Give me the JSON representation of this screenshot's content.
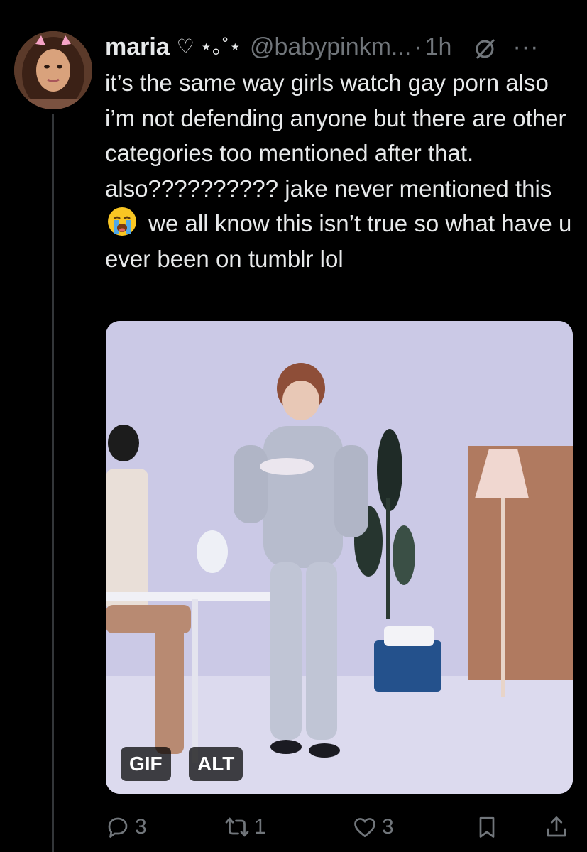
{
  "tweet": {
    "author": {
      "display_name": "maria",
      "name_decoration": "♡ ⋆｡˚⋆",
      "handle": "@babypinkm...",
      "avatar_icon": "profile-photo"
    },
    "separator": "·",
    "time": "1h",
    "more_label": "···",
    "text_part1": "it’s the same way girls watch gay porn also i’m not defending anyone but there are other categories too mentioned after that.\nalso?????????? jake never mentioned this ",
    "emoji_icon": "loudly-crying-face-emoji",
    "text_part2": " we all know this isn’t true so what have u ever been on tumblr lol",
    "media": {
      "type": "gif",
      "gif_label": "GIF",
      "alt_label": "ALT"
    },
    "actions": {
      "reply_count": "3",
      "retweet_count": "1",
      "like_count": "3"
    }
  },
  "colors": {
    "background": "#000000",
    "text_primary": "#e7e9ea",
    "text_secondary": "#71767b",
    "thread_line": "#333639"
  }
}
